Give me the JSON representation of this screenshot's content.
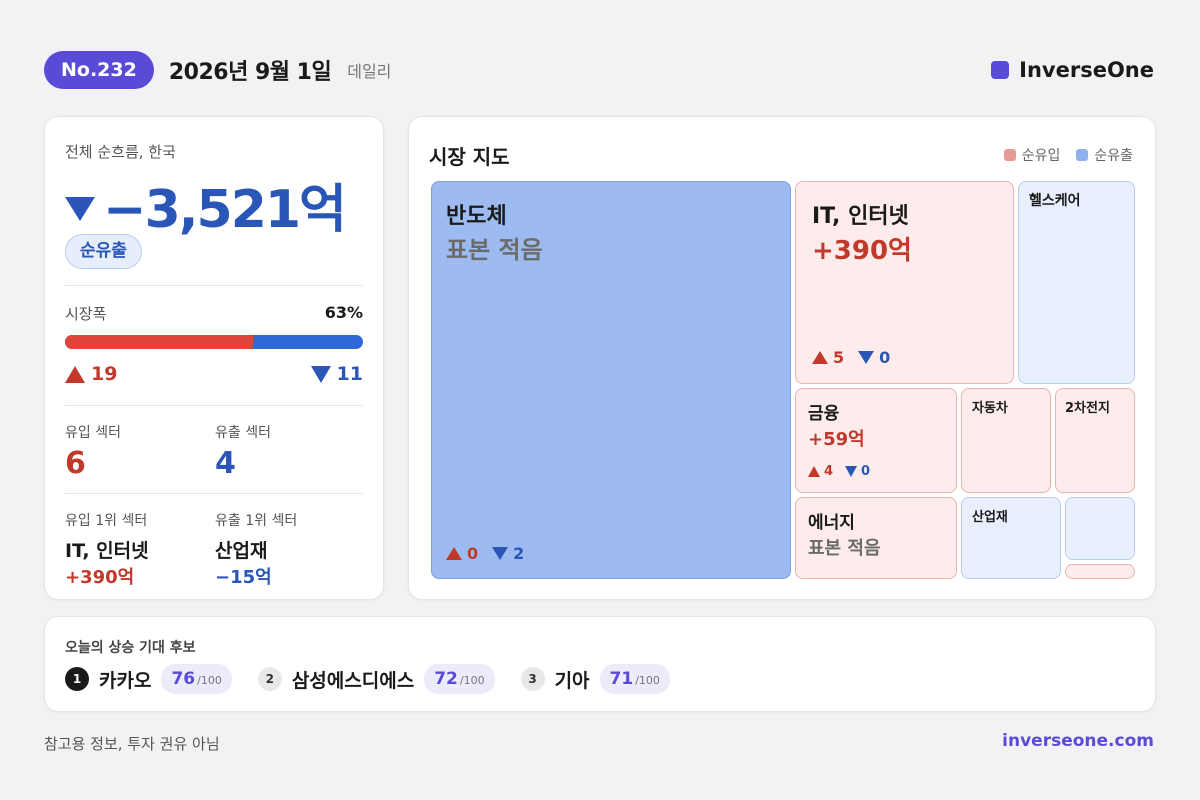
{
  "header": {
    "issue": "No.232",
    "date": "2026년 9월 1일",
    "type": "데일리",
    "brand": "InverseOne",
    "brand_color": "#5a4bd6"
  },
  "summary": {
    "title": "전체 순흐름, 한국",
    "value": "−3,521억",
    "direction": "down",
    "badge": "순유출",
    "breadth_label": "시장폭",
    "breadth_pct": "63%",
    "breadth_fraction": 0.63,
    "up_count": "19",
    "down_count": "11",
    "inflow_sectors_label": "유입 섹터",
    "inflow_sectors": "6",
    "outflow_sectors_label": "유출 섹터",
    "outflow_sectors": "4",
    "top_inflow_label": "유입 1위 섹터",
    "top_inflow_name": "IT, 인터넷",
    "top_inflow_value": "+390억",
    "top_outflow_label": "유출 1위 섹터",
    "top_outflow_name": "산업재",
    "top_outflow_value": "−15억"
  },
  "market_map": {
    "title": "시장 지도",
    "legend_inflow": "순유입",
    "legend_outflow": "순유출",
    "inflow_color": "#e89a96",
    "outflow_color": "#8fb2ee",
    "tiles": {
      "semis": {
        "name": "반도체",
        "value": "표본 적음",
        "up": "0",
        "down": "2"
      },
      "it": {
        "name": "IT, 인터넷",
        "value": "+390억",
        "up": "5",
        "down": "0"
      },
      "health": {
        "name": "헬스케어"
      },
      "finance": {
        "name": "금융",
        "value": "+59억",
        "up": "4",
        "down": "0"
      },
      "auto": {
        "name": "자동차"
      },
      "battery": {
        "name": "2차전지"
      },
      "energy": {
        "name": "에너지",
        "value": "표본 적음"
      },
      "industrial": {
        "name": "산업재"
      }
    }
  },
  "candidates": {
    "title": "오늘의 상승 기대 후보",
    "items": [
      {
        "rank": "1",
        "name": "카카오",
        "score": "76",
        "max": "/100"
      },
      {
        "rank": "2",
        "name": "삼성에스디에스",
        "score": "72",
        "max": "/100"
      },
      {
        "rank": "3",
        "name": "기아",
        "score": "71",
        "max": "/100"
      }
    ]
  },
  "footer": {
    "disclaimer": "참고용 정보, 투자 권유 아님",
    "site": "inverseone.com"
  }
}
